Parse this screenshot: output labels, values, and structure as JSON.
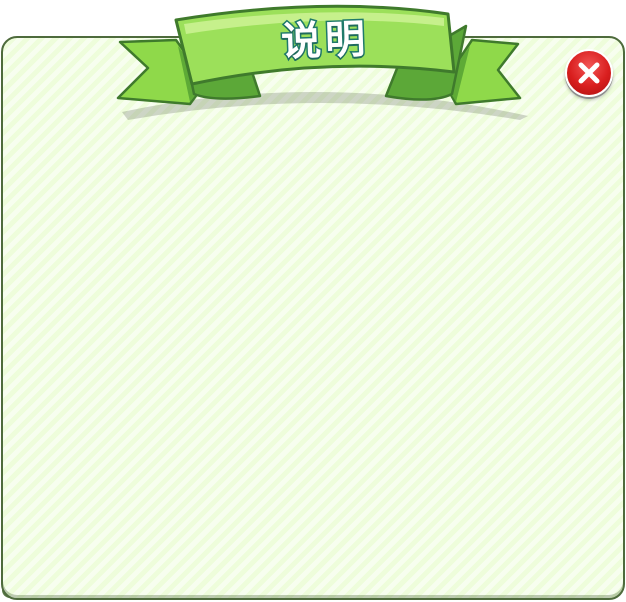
{
  "dialog": {
    "title": "说明",
    "close_icon": "close-icon",
    "colors": {
      "panel_fill": "#eefddb",
      "panel_border": "#4e6b3c",
      "ribbon_green": "#8fd94a",
      "title_stroke": "#1f7a6a",
      "close_red": "#d91e1e"
    }
  }
}
